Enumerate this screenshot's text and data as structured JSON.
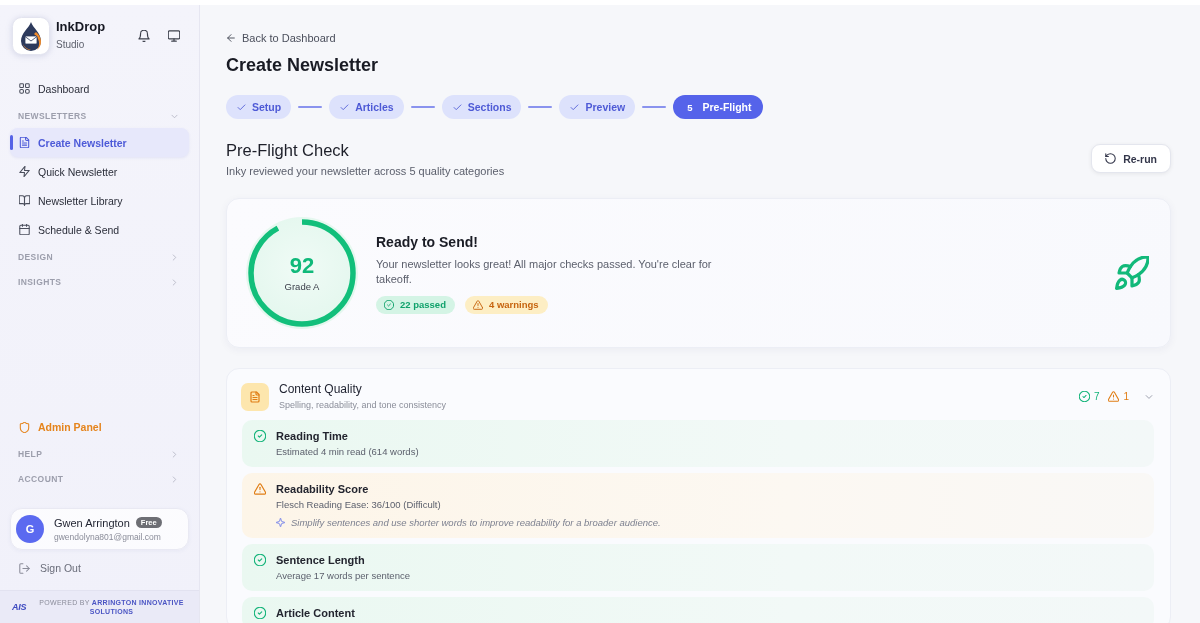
{
  "sidebar": {
    "brand": {
      "name": "InkDrop",
      "subtitle": "Studio"
    },
    "nav": [
      {
        "kind": "link",
        "label": "Dashboard",
        "selected": false
      },
      {
        "kind": "section",
        "label": "NEWSLETTERS",
        "expanded": true,
        "children": [
          {
            "label": "Create Newsletter",
            "selected": true
          },
          {
            "label": "Quick Newsletter",
            "selected": false
          },
          {
            "label": "Newsletter Library",
            "selected": false
          },
          {
            "label": "Schedule & Send",
            "selected": false
          }
        ]
      },
      {
        "kind": "section",
        "label": "DESIGN",
        "expanded": false
      },
      {
        "kind": "section",
        "label": "INSIGHTS",
        "expanded": false
      }
    ],
    "nav_bottom": [
      {
        "kind": "admin",
        "label": "Admin Panel",
        "selected": false
      },
      {
        "kind": "section",
        "label": "HELP",
        "expanded": false
      },
      {
        "kind": "section",
        "label": "ACCOUNT",
        "expanded": false
      }
    ],
    "user": {
      "initial": "G",
      "name": "Gwen Arrington",
      "plan": "Free",
      "email": "gwendolyna801@gmail.com"
    },
    "sign_out": "Sign Out",
    "footer": {
      "logo": "AIS",
      "text": "POWERED BY **ARRINGTON INNOVATIVE SOLUTIONS**"
    }
  },
  "main": {
    "back_link": "Back to Dashboard",
    "title": "Create Newsletter",
    "steps": [
      {
        "label": "Setup",
        "completed": true,
        "selected": false
      },
      {
        "label": "Articles",
        "completed": true,
        "selected": false
      },
      {
        "label": "Sections",
        "completed": true,
        "selected": false
      },
      {
        "label": "Preview",
        "completed": true,
        "selected": false
      },
      {
        "number": "5",
        "label": "Pre-Flight",
        "completed": false,
        "selected": true
      }
    ],
    "section": {
      "title": "Pre-Flight Check",
      "subtitle": "Inky reviewed your newsletter across 5 quality categories",
      "action": "Re-run"
    },
    "score": {
      "value": "92",
      "grade": "Grade A",
      "level": 0.92,
      "heading": "Ready to Send!",
      "message": "Your newsletter looks great! All major checks passed. You're clear for takeoff.",
      "badges": [
        {
          "kind": "passed",
          "label": "22 passed"
        },
        {
          "kind": "warning",
          "label": "4 warnings"
        }
      ]
    },
    "categories": [
      {
        "title": "Content Quality",
        "subtitle": "Spelling, readability, and tone consistency",
        "passed_count": "7",
        "warning_count": "1",
        "expanded": true,
        "checks": [
          {
            "kind": "pass",
            "title": "Reading Time",
            "detail": "Estimated 4 min read (614 words)"
          },
          {
            "kind": "warning",
            "title": "Readability Score",
            "detail": "Flesch Reading Ease: 36/100 (Difficult)",
            "suggestion": "Simplify sentences and use shorter words to improve readability for a broader audience."
          },
          {
            "kind": "pass",
            "title": "Sentence Length",
            "detail": "Average 17 words per sentence"
          },
          {
            "kind": "pass",
            "title": "Article Content"
          }
        ]
      }
    ]
  }
}
